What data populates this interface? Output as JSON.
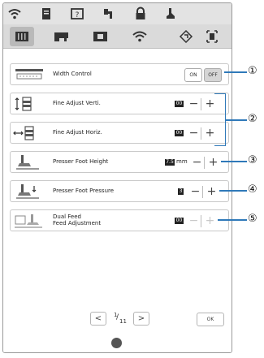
{
  "settings": [
    {
      "label": "Width Control",
      "on_label": "ON",
      "off_label": "OFF"
    },
    {
      "label": "Fine Adjust Verti.",
      "value": "00"
    },
    {
      "label": "Fine Adjust Horiz.",
      "value": "00"
    },
    {
      "label": "Presser Foot Height",
      "value": "7.5",
      "unit": "mm"
    },
    {
      "label": "Presser Foot Pressure",
      "value": "3"
    },
    {
      "label_line1": "Dual Feed",
      "label_line2": "Feed Adjustment",
      "value": "00"
    }
  ],
  "pager": {
    "current": "1",
    "total": "11",
    "prev_glyph": "<",
    "next_glyph": ">"
  },
  "ok_label": "OK",
  "stepper": {
    "minus": "−",
    "plus": "+"
  },
  "callouts": [
    "①",
    "②",
    "③",
    "④",
    "⑤"
  ],
  "colors": {
    "accent": "#2f79b9",
    "topbar": "#e3e3e3",
    "tabbar": "#dadada"
  }
}
